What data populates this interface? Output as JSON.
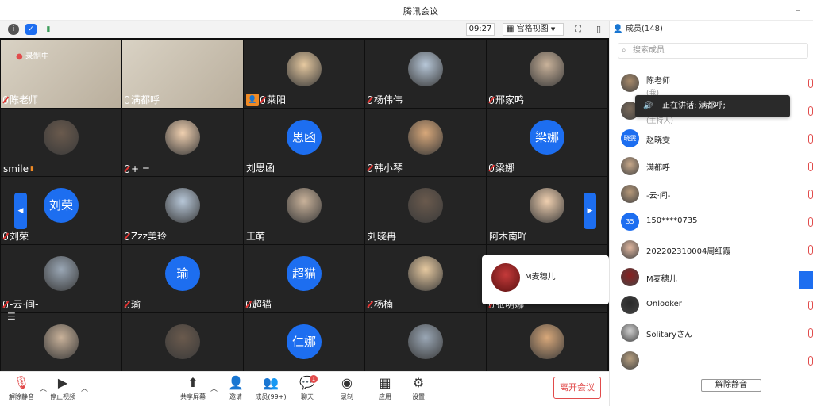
{
  "app": {
    "title": "腾讯会议",
    "time": "09:27",
    "view_mode": "宫格视图",
    "recording_text": "录制中"
  },
  "tiles": [
    {
      "name": "陈老师",
      "type": "video",
      "mic": "off"
    },
    {
      "name": "满都呼",
      "type": "video",
      "mic": "on",
      "speaking": true
    },
    {
      "name": "莱阳",
      "type": "photo",
      "mic": "off",
      "host_badge": true
    },
    {
      "name": "杨伟伟",
      "type": "photo",
      "mic": "off"
    },
    {
      "name": "邢家鸣",
      "type": "photo",
      "mic": "off"
    },
    {
      "name": "smile",
      "type": "photo",
      "mic": "none",
      "signal": true
    },
    {
      "name": "+ =",
      "type": "photo",
      "mic": "off"
    },
    {
      "name": "刘思函",
      "type": "text",
      "avatar_text": "思函",
      "mic": "none"
    },
    {
      "name": "韩小琴",
      "type": "photo",
      "mic": "off"
    },
    {
      "name": "梁娜",
      "type": "text",
      "avatar_text": "梁娜",
      "mic": "off"
    },
    {
      "name": "刘荣",
      "type": "text",
      "avatar_text": "刘荣",
      "mic": "off"
    },
    {
      "name": "Zzz美玲",
      "type": "photo",
      "mic": "off"
    },
    {
      "name": "王萌",
      "type": "photo",
      "mic": "none"
    },
    {
      "name": "刘晓冉",
      "type": "photo",
      "mic": "none"
    },
    {
      "name": "阿木南吖",
      "type": "photo",
      "mic": "none"
    },
    {
      "name": "-云·间-",
      "type": "photo",
      "mic": "off"
    },
    {
      "name": "瑜",
      "type": "text",
      "avatar_text": "瑜",
      "mic": "off"
    },
    {
      "name": "超猫",
      "type": "text",
      "avatar_text": "超猫",
      "mic": "off"
    },
    {
      "name": "杨楠",
      "type": "photo",
      "mic": "off"
    },
    {
      "name": "张明娜",
      "type": "photo",
      "mic": "off"
    },
    {
      "name": "",
      "type": "photo",
      "mic": "none"
    },
    {
      "name": "",
      "type": "photo",
      "mic": "none"
    },
    {
      "name": "",
      "type": "text",
      "avatar_text": "仁娜",
      "mic": "none"
    },
    {
      "name": "",
      "type": "photo",
      "mic": "none"
    },
    {
      "name": "",
      "type": "photo",
      "mic": "none"
    }
  ],
  "popup": {
    "name": "M麦穗儿"
  },
  "toolbar": {
    "unmute": "解除静音",
    "stop_video": "停止视频",
    "share": "共享屏幕",
    "invite": "邀请",
    "members": "成员(99+)",
    "chat": "聊天",
    "chat_badge": "1",
    "record": "录制",
    "apps": "应用",
    "settings": "设置",
    "leave": "离开会议"
  },
  "panel": {
    "title": "成员(148)",
    "search_placeholder": "搜索成员",
    "speaking_text": "正在讲话: 满都呼;",
    "members": [
      {
        "name": "陈老师",
        "sub": "(我)",
        "avatar": "photo"
      },
      {
        "name": "",
        "sub": "(主持人)",
        "avatar": "photo"
      },
      {
        "name": "赵晓雯",
        "sub": "",
        "avatar": "text",
        "avatar_text": "晓雯"
      },
      {
        "name": "满都呼",
        "sub": "",
        "avatar": "photo"
      },
      {
        "name": "-云·间-",
        "sub": "",
        "avatar": "photo"
      },
      {
        "name": "150****0735",
        "sub": "",
        "avatar": "text",
        "avatar_text": "35"
      },
      {
        "name": "202202310004周红霞",
        "sub": "",
        "avatar": "photo"
      },
      {
        "name": "M麦穗儿",
        "sub": "",
        "avatar": "photo"
      },
      {
        "name": "Onlooker",
        "sub": "",
        "avatar": "photo"
      },
      {
        "name": "Solitaryさん",
        "sub": "",
        "avatar": "photo"
      },
      {
        "name": "",
        "sub": "",
        "avatar": "photo"
      }
    ],
    "unmute_all": "解除静音"
  },
  "colors": {
    "accent": "#1d6ef0",
    "danger": "#e14b4b",
    "speaking": "#3c9c5a"
  }
}
